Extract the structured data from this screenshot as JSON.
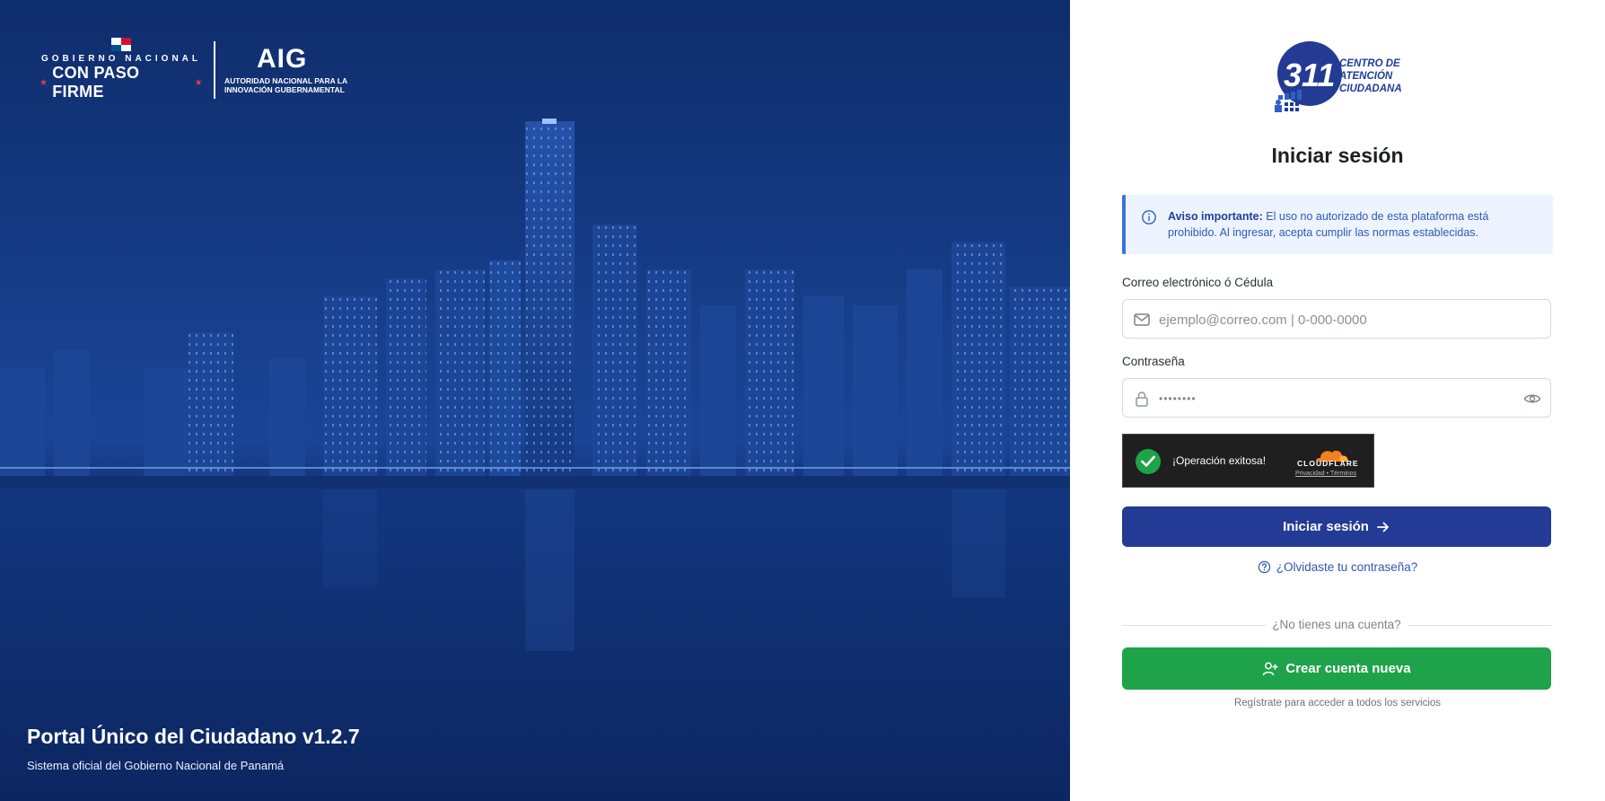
{
  "hero": {
    "gov_line1": "GOBIERNO NACIONAL",
    "gov_line2": "CON PASO FIRME",
    "aig_title": "AIG",
    "aig_sub_line1": "AUTORIDAD NACIONAL PARA LA",
    "aig_sub_line2": "INNOVACIÓN GUBERNAMENTAL",
    "portal_title": "Portal Único del Ciudadano v1.2.7",
    "portal_subtitle": "Sistema oficial del Gobierno Nacional de Panamá"
  },
  "logo": {
    "number": "311",
    "line1": "CENTRO DE",
    "line2": "ATENCIÓN",
    "line3": "CIUDADANA"
  },
  "login": {
    "title": "Iniciar sesión",
    "notice_bold": "Aviso importante:",
    "notice_text": " El uso no autorizado de esta plataforma está prohibido. Al ingresar, acepta cumplir las normas establecidas.",
    "email_label": "Correo electrónico ó Cédula",
    "email_placeholder": "ejemplo@correo.com | 0-000-0000",
    "password_label": "Contraseña",
    "password_value": "••••••••",
    "captcha_status": "¡Operación exitosa!",
    "captcha_brand": "CLOUDFLARE",
    "captcha_links": "Privacidad • Términos",
    "submit_label": "Iniciar sesión",
    "forgot_label": "¿Olvidaste tu contraseña?",
    "no_account_label": "¿No tienes una cuenta?",
    "create_label": "Crear cuenta nueva",
    "create_sub": "Regístrate para acceder a todos los servicios"
  },
  "colors": {
    "primary": "#233b94",
    "success": "#1fa34a",
    "notice_bg": "#eef4ff",
    "notice_border": "#3b74d6"
  },
  "icons": [
    "info-icon",
    "mail-icon",
    "lock-icon",
    "eye-icon",
    "check-icon",
    "arrow-right-icon",
    "help-circle-icon",
    "user-plus-icon"
  ]
}
